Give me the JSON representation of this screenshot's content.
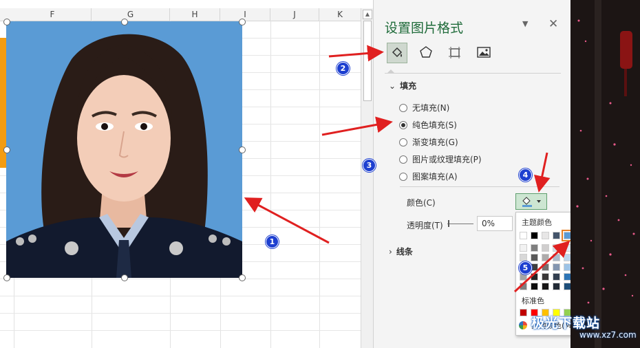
{
  "sheet": {
    "columns": [
      "F",
      "G",
      "H",
      "I",
      "J",
      "K"
    ]
  },
  "pane": {
    "title": "设置图片格式",
    "fill_section": "填充",
    "line_section": "线条",
    "fill_options": [
      {
        "label": "无填充(N)",
        "selected": false
      },
      {
        "label": "纯色填充(S)",
        "selected": true
      },
      {
        "label": "渐变填充(G)",
        "selected": false
      },
      {
        "label": "图片或纹理填充(P)",
        "selected": false
      },
      {
        "label": "图案填充(A)",
        "selected": false
      }
    ],
    "color_label": "颜色(C)",
    "transparency_label": "透明度(T)",
    "transparency_value": "0%"
  },
  "palette": {
    "theme_title": "主题颜色",
    "standard_title": "标准色",
    "more_colors": "其他颜色(M)...",
    "theme_top": [
      "#ffffff",
      "#000000",
      "#e7e6e6",
      "#44546a",
      "#5b9bd5",
      "#ed7d31",
      "#a5a5a5",
      "#ffc000",
      "#4472c4",
      "#70ad47"
    ],
    "theme_shades": [
      [
        "#f2f2f2",
        "#7f7f7f",
        "#d0cece",
        "#d6dce4",
        "#deebf6",
        "#fbe5d5",
        "#ededed",
        "#fff2cc",
        "#d9e2f3",
        "#e2efd9"
      ],
      [
        "#d8d8d8",
        "#595959",
        "#aeabab",
        "#adb9ca",
        "#bdd7ee",
        "#f7cbac",
        "#dbdbdb",
        "#fee599",
        "#b4c6e7",
        "#c5e0b3"
      ],
      [
        "#bfbfbf",
        "#3f3f3f",
        "#757070",
        "#8496b0",
        "#9dc3e6",
        "#f4b183",
        "#c9c9c9",
        "#ffd965",
        "#8eaadb",
        "#a8d08d"
      ],
      [
        "#a5a5a5",
        "#262626",
        "#3a3838",
        "#323f4f",
        "#2e75b5",
        "#c55a11",
        "#7b7b7b",
        "#bf9000",
        "#2f5496",
        "#538135"
      ],
      [
        "#7f7f7f",
        "#0c0c0c",
        "#171616",
        "#222a35",
        "#1e4e79",
        "#833c0b",
        "#525252",
        "#7f6000",
        "#1f3864",
        "#375623"
      ]
    ],
    "standard": [
      "#c00000",
      "#ff0000",
      "#ffc000",
      "#ffff00",
      "#92d050",
      "#00b050",
      "#00b0f0",
      "#0070c0",
      "#002060",
      "#7030a0"
    ],
    "selected_theme_color": "#5b9bd5"
  },
  "badges": [
    "1",
    "2",
    "3",
    "4",
    "5"
  ],
  "watermark": {
    "brand": "极光下载站",
    "url": "www.xz7.com"
  },
  "colors": {
    "photo_background": "#5a9bd5",
    "annotation_arrow": "#e02020",
    "pane_title": "#1f6b3a"
  }
}
